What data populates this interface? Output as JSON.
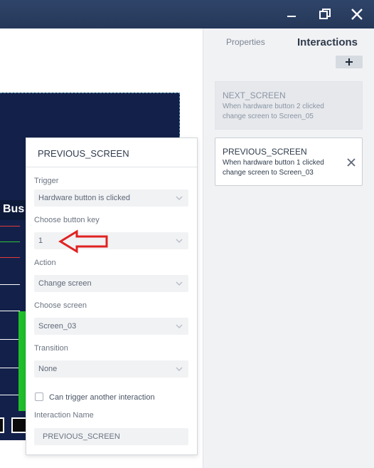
{
  "window": {
    "controls": [
      "minimize-icon",
      "restore-icon",
      "close-icon"
    ]
  },
  "panel": {
    "tabs": {
      "properties": "Properties",
      "interactions": "Interactions"
    },
    "add_label": "+"
  },
  "interactions": [
    {
      "title": "NEXT_SCREEN",
      "desc_line1": "When hardware button 2 clicked",
      "desc_line2": "change screen to Screen_05"
    },
    {
      "title": "PREVIOUS_SCREEN",
      "desc_line1": "When hardware button 1 clicked",
      "desc_line2": "change screen to Screen_03"
    }
  ],
  "preview": {
    "bus_label": "Bus"
  },
  "editor": {
    "title": "PREVIOUS_SCREEN",
    "trigger_label": "Trigger",
    "trigger_value": "Hardware button is clicked",
    "button_key_label": "Choose button key",
    "button_key_value": "1",
    "action_label": "Action",
    "action_value": "Change screen",
    "screen_label": "Choose screen",
    "screen_value": "Screen_03",
    "transition_label": "Transition",
    "transition_value": "None",
    "chain_label": "Can trigger another interaction",
    "name_label": "Interaction Name",
    "name_value": "PREVIOUS_SCREEN"
  },
  "colors": {
    "titlebar": "#2f4469",
    "arrow": "#e02222",
    "preview_bg": "#13214a",
    "green_bar": "#1fbf2a"
  }
}
